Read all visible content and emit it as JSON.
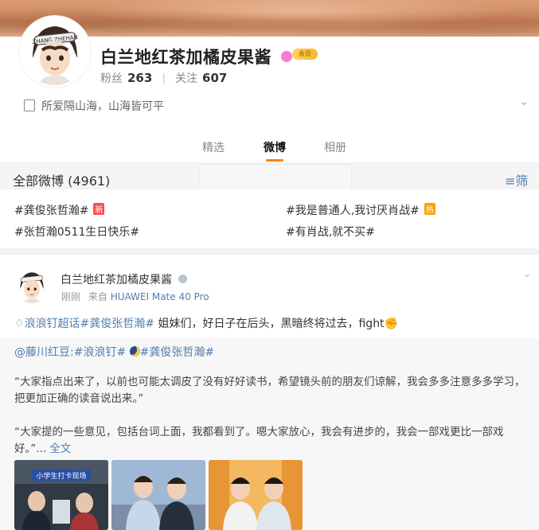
{
  "profile": {
    "name": "白兰地红茶加橘皮果酱",
    "vip_label": "会员",
    "avatar_text": "ZHANG ZHEHAN",
    "followers_label": "粉丝",
    "followers_count": "263",
    "following_label": "关注",
    "following_count": "607",
    "bio": "所爱隔山海，山海皆可平"
  },
  "tabs": [
    {
      "label": "精选"
    },
    {
      "label": "微博"
    },
    {
      "label": "相册"
    }
  ],
  "filter": {
    "count_label": "全部微博 (4961)",
    "filter_label": "筛选"
  },
  "topics": [
    {
      "text": "#龚俊张哲瀚#",
      "tag": "新"
    },
    {
      "text": "#我是普通人,我讨厌肖战#",
      "tag": "热"
    },
    {
      "text": "#张哲瀚0511生日快乐#"
    },
    {
      "text": "#有肖战,就不买#"
    }
  ],
  "post": {
    "author": "白兰地红茶加橘皮果酱",
    "time": "刚刚",
    "source_prefix": "来自",
    "source": "HUAWEI Mate 40 Pro",
    "text_link": "浪浪钉超话#龚俊张哲瀚#",
    "text_body": "姐妹们，好日子在后头，黑暗终将过去，fight",
    "repost_user": "@藤川红豆:",
    "repost_tag1": "#浪浪钉#",
    "repost_tag2": "#龚俊张哲瀚#",
    "para1": "“大家指点出来了，以前也可能太调皮了没有好好读书，希望镜头前的朋友们谅解，我会多多注意多多学习，把更加正确的读音说出来。”",
    "para2": "“大家提的一些意见，包括台词上面，我都看到了。嗯大家放心，我会有进步的，我会一部戏更比一部戏好。”...",
    "more_label": "全文",
    "thumb1_caption": "小学生打卡现场"
  },
  "colors": {
    "accent": "#ff8200",
    "link": "#507daf"
  }
}
